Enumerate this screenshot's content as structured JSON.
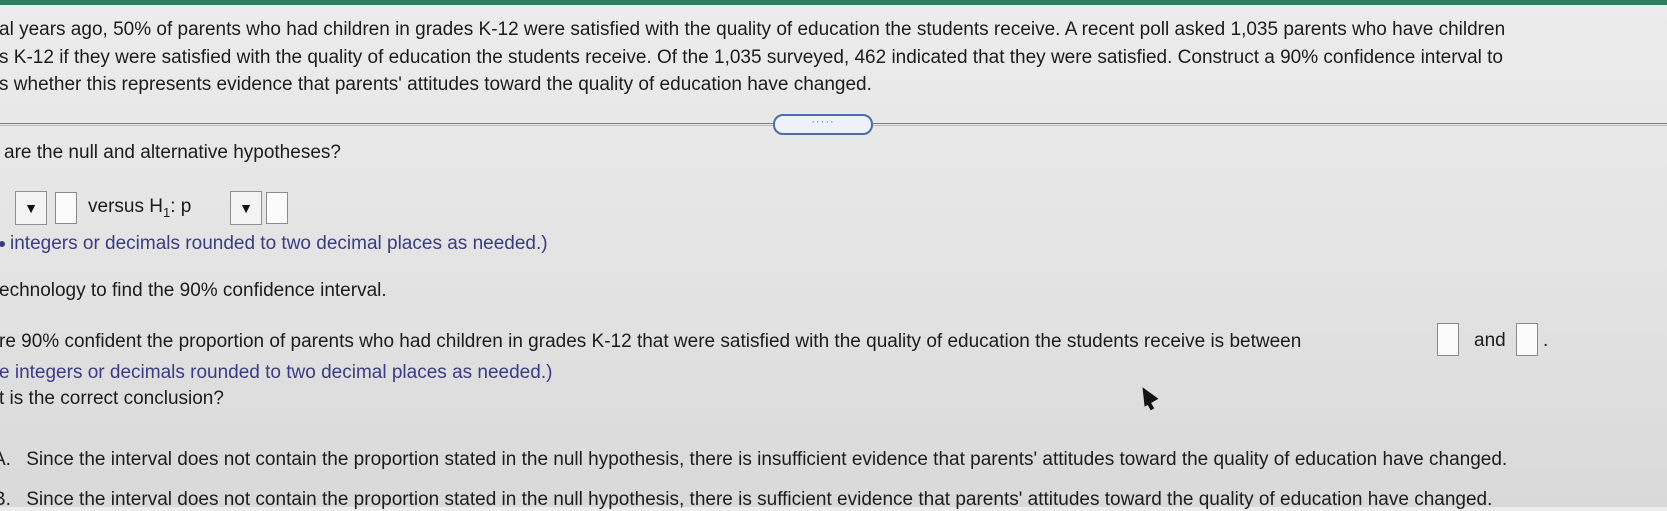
{
  "problem": {
    "line1": "al years ago, 50% of parents who had children in grades K-12 were satisfied with the quality of education the students receive. A recent poll asked 1,035 parents who have children",
    "line2": "s K-12 if they were satisfied with the quality of education the students receive. Of the 1,035 surveyed, 462 indicated that they were satisfied. Construct a 90% confidence interval to",
    "line3": "s whether this represents evidence that parents' attitudes toward the quality of education have changed."
  },
  "expander_label": "·····",
  "hypotheses": {
    "question": "are the null and alternative hypotheses?",
    "dropdown_glyph": "▼",
    "versus_text": "versus H",
    "h1_subscript": "1",
    "h1_suffix": ": p",
    "note": "integers or decimals rounded to two decimal places as needed.)"
  },
  "interval": {
    "instruction": "echnology to find the 90% confidence interval.",
    "statement": "re 90% confident the proportion of parents who had children in grades K-12 that were satisfied with the quality of education the students receive is between",
    "and_text": "and",
    "period": ".",
    "note": "e integers or decimals rounded to two decimal places as needed.)"
  },
  "conclusion": {
    "question": "t is the correct conclusion?",
    "option_a_letter": "A.",
    "option_a": "Since the interval does not contain the proportion stated in the null hypothesis, there is insufficient evidence that parents' attitudes toward the quality of education have changed.",
    "option_b_letter": "B.",
    "option_b": "Since the interval does not contain the proportion stated in the null hypothesis, there is sufficient evidence that parents' attitudes toward the quality of education have changed."
  }
}
